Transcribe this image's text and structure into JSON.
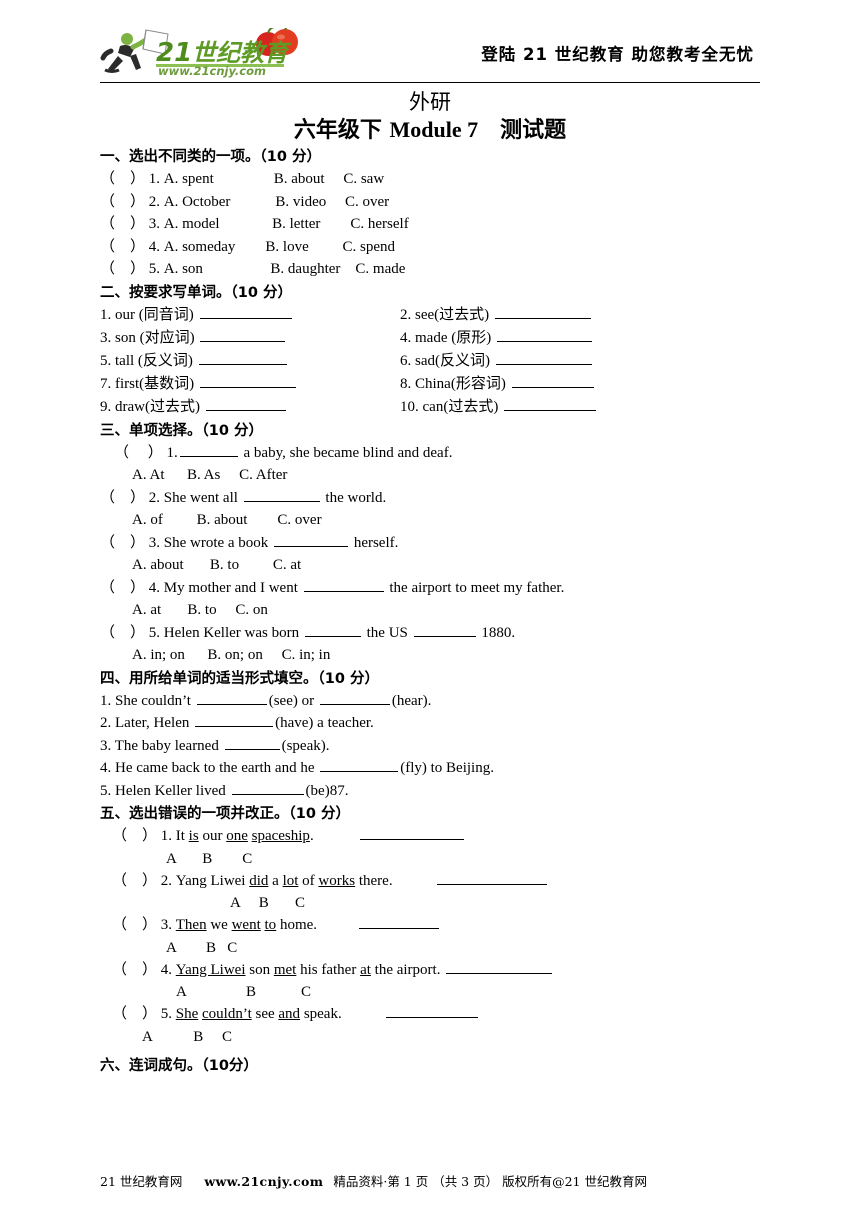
{
  "header": {
    "logo_text_main": "21世纪教育",
    "logo_text_url": "www.21cnjy.com",
    "slogan": "登陆 21 世纪教育      助您教考全无忧"
  },
  "title": {
    "line1": "外研",
    "line2_prefix": "六年级下 ",
    "line2_module": "Module 7",
    "line2_suffix": "　测试题"
  },
  "sections": [
    {
      "heading": "一、选出不同类的一项。（10 分）",
      "items": [
        "（    ） 1. A. spent                B. about     C. saw",
        "（    ） 2. A. October            B. video     C. over",
        "（    ） 3. A. model              B. letter        C. herself",
        "（    ） 4. A. someday        B. love         C. spend",
        "（    ） 5. A. son                  B. daughter    C. made"
      ]
    },
    {
      "heading": "二、按要求写单词。（10 分）",
      "words": [
        {
          "num": "1.",
          "word": "our ",
          "hint": "(同音词)",
          "blank": 92
        },
        {
          "num": "2.",
          "word": "see",
          "hint": "(过去式)",
          "blank": 96
        },
        {
          "num": "3.",
          "word": "son ",
          "hint": "(对应词)",
          "blank": 85
        },
        {
          "num": "4.",
          "word": "made ",
          "hint": "(原形)",
          "blank": 95
        },
        {
          "num": "5.",
          "word": "tall ",
          "hint": "(反义词)",
          "blank": 88
        },
        {
          "num": "6.",
          "word": "sad",
          "hint": "(反义词)",
          "blank": 96
        },
        {
          "num": "7.",
          "word": "first",
          "hint": "(基数词)",
          "blank": 96
        },
        {
          "num": "8.",
          "word": "China",
          "hint": "(形容词)",
          "blank": 82
        },
        {
          "num": "9.",
          "word": "draw",
          "hint": "(过去式)",
          "blank": 80
        },
        {
          "num": "10.",
          "word": "can",
          "hint": "(过去式)",
          "blank": 92
        }
      ]
    },
    {
      "heading": "三、单项选择。（10 分）",
      "items": [
        {
          "q_pre": "（     ） 1.",
          "q_blank": 58,
          "q_post": " a baby, she became blind and deaf.",
          "indent": 14,
          "opts": "A. At      B. As     C. After",
          "opts_indent": 32
        },
        {
          "q_pre": "（    ） 2. She went all ",
          "q_blank": 76,
          "q_post": " the world.",
          "indent": 0,
          "opts": "A. of         B. about        C. over",
          "opts_indent": 32
        },
        {
          "q_pre": "（    ） 3. She wrote a book ",
          "q_blank": 74,
          "q_post": " herself.",
          "indent": 0,
          "opts": "A. about       B. to         C. at",
          "opts_indent": 32
        },
        {
          "q_pre": "（    ） 4. My mother and I went ",
          "q_blank": 80,
          "q_post": " the airport to meet my father.",
          "indent": 0,
          "opts": "A. at       B. to     C. on",
          "opts_indent": 32
        },
        {
          "q_pre": "（    ） 5. Helen Keller was born ",
          "q_blank": 56,
          "q_mid": " the US ",
          "q_blank2": 62,
          "q_post": " 1880.",
          "indent": 0,
          "opts": "A. in; on      B. on; on     C. in; in",
          "opts_indent": 32
        }
      ]
    },
    {
      "heading": "四、用所给单词的适当形式填空。（10 分）",
      "items": [
        {
          "pre": "1. She couldn’t ",
          "blank": 70,
          "mid": "(see) or ",
          "blank2": 70,
          "post": "(hear)."
        },
        {
          "pre": "2. Later, Helen ",
          "blank": 78,
          "post": "(have) a teacher."
        },
        {
          "pre": "3. The baby learned ",
          "blank": 55,
          "post": "(speak)."
        },
        {
          "pre": "4. He came back to the earth and he ",
          "blank": 78,
          "post": "(fly) to Beijing."
        },
        {
          "pre": "5. Helen Keller lived ",
          "blank": 72,
          "post": "(be)87."
        }
      ]
    },
    {
      "heading": "五、选出错误的一项并改正。（10 分）",
      "items": [
        {
          "pre": "（    ） 1. It ",
          "indent": 12,
          "parts": [
            {
              "t": "is",
              "u": true
            },
            {
              "t": " our ",
              "u": false
            },
            {
              "t": "one",
              "u": true
            },
            {
              "t": " ",
              "u": false
            },
            {
              "t": "spaceship",
              "u": true
            },
            {
              "t": ".",
              "u": false
            }
          ],
          "blank": 104,
          "blank_gap": 44,
          "abc": "A       B        C",
          "abc_indent": 66
        },
        {
          "pre": "（    ） 2. Yang Liwei ",
          "indent": 12,
          "parts": [
            {
              "t": "did",
              "u": true
            },
            {
              "t": " a ",
              "u": false
            },
            {
              "t": "lot",
              "u": true
            },
            {
              "t": " of ",
              "u": false
            },
            {
              "t": "works",
              "u": true
            },
            {
              "t": " there.",
              "u": false
            }
          ],
          "blank": 110,
          "blank_gap": 42,
          "abc": "A     B       C",
          "abc_indent": 130
        },
        {
          "pre": "（    ） 3. ",
          "indent": 12,
          "parts": [
            {
              "t": "Then",
              "u": true
            },
            {
              "t": " we ",
              "u": false
            },
            {
              "t": "went",
              "u": true
            },
            {
              "t": " ",
              "u": false
            },
            {
              "t": "to",
              "u": true
            },
            {
              "t": " home.",
              "u": false
            }
          ],
          "blank": 80,
          "blank_gap": 40,
          "abc": "A        B   C",
          "abc_indent": 66
        },
        {
          "pre": "（    ） 4. ",
          "indent": 12,
          "parts": [
            {
              "t": "Yang Liwei",
              "u": true
            },
            {
              "t": " son ",
              "u": false
            },
            {
              "t": "met",
              "u": true
            },
            {
              "t": " his father ",
              "u": false
            },
            {
              "t": "at",
              "u": true
            },
            {
              "t": " the airport.",
              "u": false
            }
          ],
          "blank": 106,
          "blank_gap": 4,
          "abc": "A                B            C",
          "abc_indent": 76
        },
        {
          "pre": "（    ） 5. ",
          "indent": 12,
          "parts": [
            {
              "t": "She",
              "u": true
            },
            {
              "t": " ",
              "u": false
            },
            {
              "t": "couldn’t",
              "u": true
            },
            {
              "t": " see ",
              "u": false
            },
            {
              "t": "and",
              "u": true
            },
            {
              "t": " speak.",
              "u": false
            }
          ],
          "blank": 92,
          "blank_gap": 42,
          "abc": "A           B     C",
          "abc_indent": 42
        }
      ]
    },
    {
      "heading": "六、连词成句。（10分）"
    }
  ],
  "footer": {
    "site": "21 世纪教育网",
    "url": "www.21cnjy.com",
    "meta": "精品资料·第 1 页 （共 3 页） 版权所有@21 世纪教育网"
  },
  "colors": {
    "logo_green": "#6aa832",
    "logo_green_dark": "#3f7a1e",
    "logo_red": "#cf2222",
    "rule": "#000000"
  }
}
